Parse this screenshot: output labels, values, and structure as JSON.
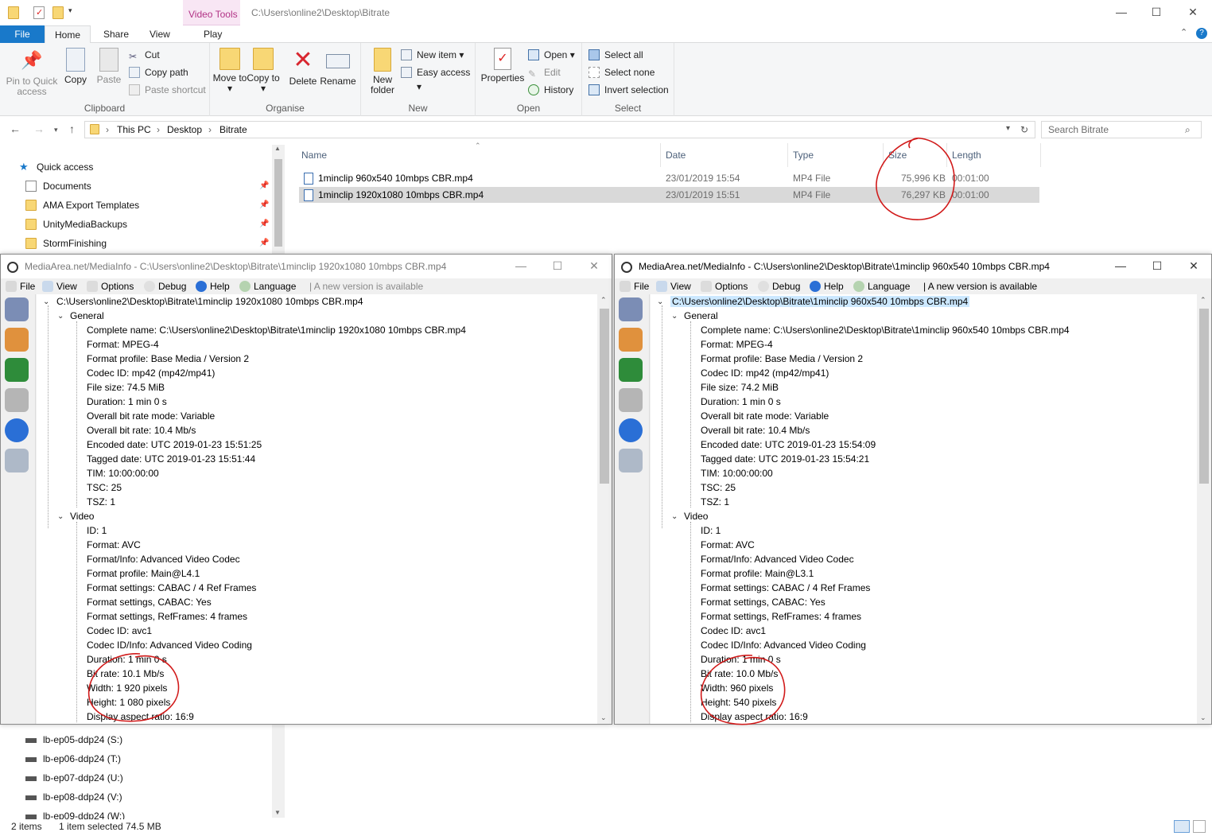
{
  "explorer": {
    "title_path": "C:\\Users\\online2\\Desktop\\Bitrate",
    "context_tab": "Video Tools",
    "tabs": [
      "File",
      "Home",
      "Share",
      "View",
      "Play"
    ],
    "ribbon": {
      "clipboard": {
        "label": "Clipboard",
        "pin": "Pin to Quick access",
        "copy": "Copy",
        "paste": "Paste",
        "cut": "Cut",
        "copy_path": "Copy path",
        "paste_shortcut": "Paste shortcut"
      },
      "organise": {
        "label": "Organise",
        "move_to": "Move to ▾",
        "copy_to": "Copy to ▾",
        "delete": "Delete",
        "rename": "Rename"
      },
      "new": {
        "label": "New",
        "new_folder": "New folder",
        "new_item": "New item ▾",
        "easy_access": "Easy access ▾"
      },
      "open": {
        "label": "Open",
        "properties": "Properties",
        "open": "Open ▾",
        "edit": "Edit",
        "history": "History"
      },
      "select": {
        "label": "Select",
        "select_all": "Select all",
        "select_none": "Select none",
        "invert": "Invert selection"
      }
    },
    "breadcrumb": [
      "This PC",
      "Desktop",
      "Bitrate"
    ],
    "search_placeholder": "Search Bitrate",
    "nav": {
      "quick_access": "Quick access",
      "items": [
        "Documents",
        "AMA Export Templates",
        "UnityMediaBackups",
        "StormFinishing"
      ],
      "drives": [
        "lb-ep05-ddp24 (S:)",
        "lb-ep06-ddp24 (T:)",
        "lb-ep07-ddp24 (U:)",
        "lb-ep08-ddp24 (V:)",
        "lb-ep09-ddp24 (W:)"
      ]
    },
    "columns": [
      "Name",
      "Date",
      "Type",
      "Size",
      "Length"
    ],
    "files": [
      {
        "name": "1minclip 960x540 10mbps CBR.mp4",
        "date": "23/01/2019 15:54",
        "type": "MP4 File",
        "size": "75,996 KB",
        "length": "00:01:00",
        "selected": false
      },
      {
        "name": "1minclip 1920x1080 10mbps CBR.mp4",
        "date": "23/01/2019 15:51",
        "type": "MP4 File",
        "size": "76,297 KB",
        "length": "00:01:00",
        "selected": true
      }
    ],
    "status": {
      "count": "2 items",
      "selection": "1 item selected  74.5 MB"
    }
  },
  "mediainfo_left": {
    "title": "MediaArea.net/MediaInfo - C:\\Users\\online2\\Desktop\\Bitrate\\1minclip 1920x1080 10mbps CBR.mp4",
    "menu": [
      "File",
      "View",
      "Options",
      "Debug",
      "Help",
      "Language",
      "| A new version is available"
    ],
    "root": "C:\\Users\\online2\\Desktop\\Bitrate\\1minclip 1920x1080 10mbps CBR.mp4",
    "general_label": "General",
    "general": [
      "Complete name: C:\\Users\\online2\\Desktop\\Bitrate\\1minclip 1920x1080 10mbps CBR.mp4",
      "Format: MPEG-4",
      "Format profile: Base Media / Version 2",
      "Codec ID: mp42 (mp42/mp41)",
      "File size: 74.5 MiB",
      "Duration: 1 min 0 s",
      "Overall bit rate mode: Variable",
      "Overall bit rate: 10.4 Mb/s",
      "Encoded date: UTC 2019-01-23 15:51:25",
      "Tagged date: UTC 2019-01-23 15:51:44",
      "TIM: 10:00:00:00",
      "TSC: 25",
      "TSZ: 1"
    ],
    "video_label": "Video",
    "video": [
      "ID: 1",
      "Format: AVC",
      "Format/Info: Advanced Video Codec",
      "Format profile: Main@L4.1",
      "Format settings: CABAC / 4 Ref Frames",
      "Format settings, CABAC: Yes",
      "Format settings, RefFrames: 4 frames",
      "Codec ID: avc1",
      "Codec ID/Info: Advanced Video Coding",
      "Duration: 1 min 0 s",
      "Bit rate: 10.1 Mb/s",
      "Width: 1 920 pixels",
      "Height: 1 080 pixels",
      "Display aspect ratio: 16:9"
    ]
  },
  "mediainfo_right": {
    "title": "MediaArea.net/MediaInfo - C:\\Users\\online2\\Desktop\\Bitrate\\1minclip 960x540 10mbps CBR.mp4",
    "menu": [
      "File",
      "View",
      "Options",
      "Debug",
      "Help",
      "Language",
      "| A new version is available"
    ],
    "root": "C:\\Users\\online2\\Desktop\\Bitrate\\1minclip 960x540 10mbps CBR.mp4",
    "general_label": "General",
    "general": [
      "Complete name: C:\\Users\\online2\\Desktop\\Bitrate\\1minclip 960x540 10mbps CBR.mp4",
      "Format: MPEG-4",
      "Format profile: Base Media / Version 2",
      "Codec ID: mp42 (mp42/mp41)",
      "File size: 74.2 MiB",
      "Duration: 1 min 0 s",
      "Overall bit rate mode: Variable",
      "Overall bit rate: 10.4 Mb/s",
      "Encoded date: UTC 2019-01-23 15:54:09",
      "Tagged date: UTC 2019-01-23 15:54:21",
      "TIM: 10:00:00:00",
      "TSC: 25",
      "TSZ: 1"
    ],
    "video_label": "Video",
    "video": [
      "ID: 1",
      "Format: AVC",
      "Format/Info: Advanced Video Codec",
      "Format profile: Main@L3.1",
      "Format settings: CABAC / 4 Ref Frames",
      "Format settings, CABAC: Yes",
      "Format settings, RefFrames: 4 frames",
      "Codec ID: avc1",
      "Codec ID/Info: Advanced Video Coding",
      "Duration: 1 min 0 s",
      "Bit rate: 10.0 Mb/s",
      "Width: 960 pixels",
      "Height: 540 pixels",
      "Display aspect ratio: 16:9"
    ]
  },
  "colors": {
    "accent": "#1979ca",
    "selection": "#d9d9d9",
    "context_tab": "#b23386",
    "annotation": "#d11a1a"
  }
}
